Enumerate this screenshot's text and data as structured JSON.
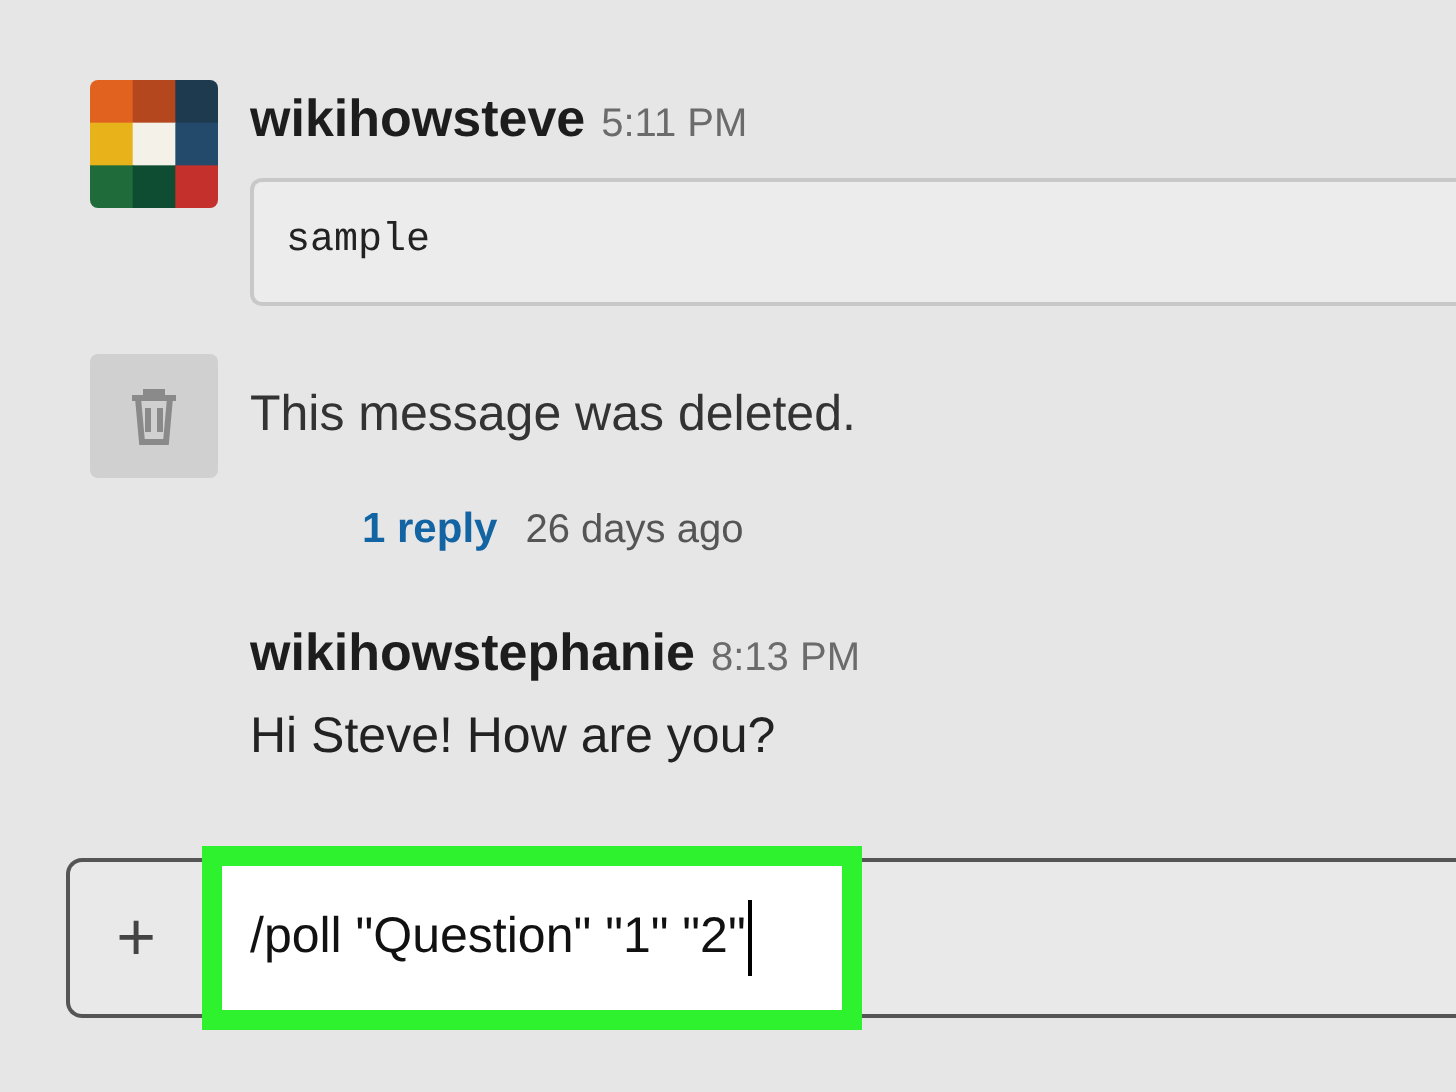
{
  "messages": [
    {
      "kind": "message",
      "author": "wikihowsteve",
      "time": "5:11 PM",
      "code": "sample"
    },
    {
      "kind": "deleted",
      "text": "This message was deleted.",
      "replies": "1 reply",
      "reply_age": "26 days ago"
    },
    {
      "kind": "follow_up",
      "author": "wikihowstephanie",
      "time": "8:13 PM",
      "text": "Hi Steve! How are you?"
    }
  ],
  "composer": {
    "button": "+",
    "value": "/poll \"Question\" \"1\" \"2\""
  }
}
